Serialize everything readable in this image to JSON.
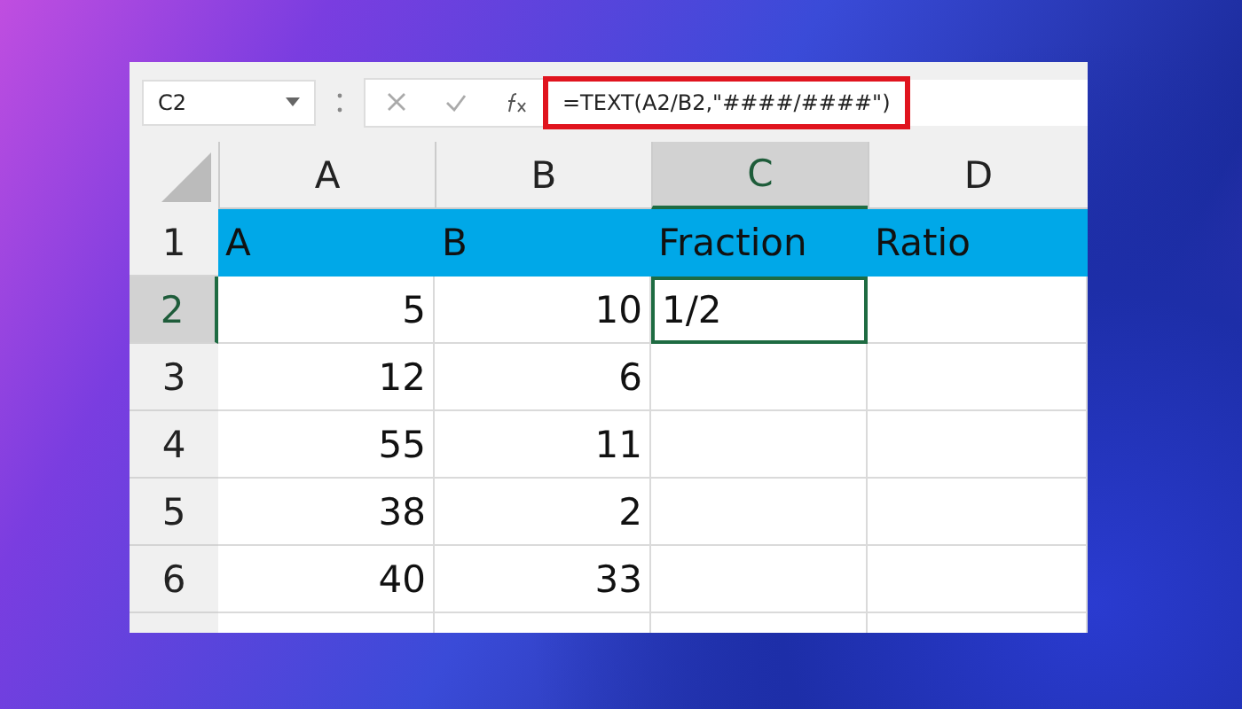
{
  "name_box": {
    "value": "C2"
  },
  "formula_bar": {
    "value": "=TEXT(A2/B2,\"####/####\")",
    "highlighted": true
  },
  "columns": [
    {
      "label": "A",
      "selected": false
    },
    {
      "label": "B",
      "selected": false
    },
    {
      "label": "C",
      "selected": true
    },
    {
      "label": "D",
      "selected": false
    }
  ],
  "rows": [
    {
      "label": "1",
      "kind": "header",
      "selected": false,
      "cells": [
        {
          "text": "A",
          "kind": "text",
          "selected": false
        },
        {
          "text": "B",
          "kind": "text",
          "selected": false
        },
        {
          "text": "Fraction",
          "kind": "text",
          "selected": false
        },
        {
          "text": "Ratio",
          "kind": "text",
          "selected": false
        }
      ]
    },
    {
      "label": "2",
      "kind": "data",
      "selected": true,
      "cells": [
        {
          "text": "5",
          "kind": "number",
          "selected": false
        },
        {
          "text": "10",
          "kind": "number",
          "selected": false
        },
        {
          "text": "1/2",
          "kind": "text",
          "selected": true
        },
        {
          "selected": false
        }
      ]
    },
    {
      "label": "3",
      "kind": "data",
      "selected": false,
      "cells": [
        {
          "text": "12",
          "kind": "number",
          "selected": false
        },
        {
          "text": "6",
          "kind": "number",
          "selected": false
        },
        {
          "selected": false
        },
        {
          "selected": false
        }
      ]
    },
    {
      "label": "4",
      "kind": "data",
      "selected": false,
      "cells": [
        {
          "text": "55",
          "kind": "number",
          "selected": false
        },
        {
          "text": "11",
          "kind": "number",
          "selected": false
        },
        {
          "selected": false
        },
        {
          "selected": false
        }
      ]
    },
    {
      "label": "5",
      "kind": "data",
      "selected": false,
      "cells": [
        {
          "text": "38",
          "kind": "number",
          "selected": false
        },
        {
          "text": "2",
          "kind": "number",
          "selected": false
        },
        {
          "selected": false
        },
        {
          "selected": false
        }
      ]
    },
    {
      "label": "6",
      "kind": "data",
      "selected": false,
      "cells": [
        {
          "text": "40",
          "kind": "number",
          "selected": false
        },
        {
          "text": "33",
          "kind": "number",
          "selected": false
        },
        {
          "selected": false
        },
        {
          "selected": false
        }
      ]
    }
  ]
}
